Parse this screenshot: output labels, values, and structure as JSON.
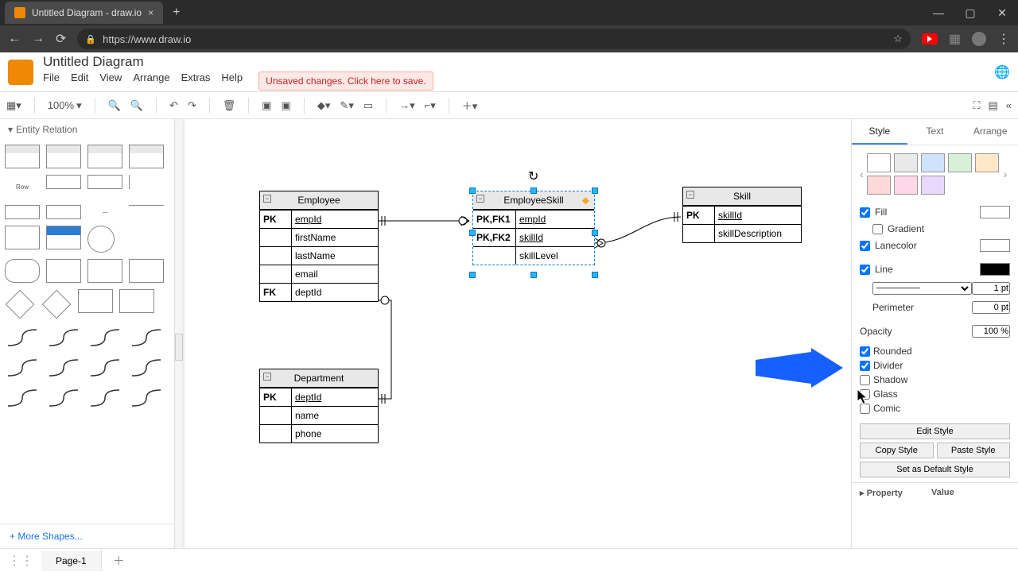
{
  "browser": {
    "tab_title": "Untitled Diagram - draw.io",
    "url": "https://www.draw.io"
  },
  "app": {
    "doc_title": "Untitled Diagram",
    "menus": [
      "File",
      "Edit",
      "View",
      "Arrange",
      "Extras",
      "Help"
    ],
    "unsaved_msg": "Unsaved changes. Click here to save.",
    "zoom": "100%"
  },
  "sidebar": {
    "category": "Entity Relation",
    "row_label": "Row",
    "more_shapes": "+ More Shapes..."
  },
  "canvas": {
    "tables": {
      "employee": {
        "title": "Employee",
        "rows": [
          {
            "k": "PK",
            "v": "empId",
            "u": true
          },
          {
            "k": "",
            "v": "firstName"
          },
          {
            "k": "",
            "v": "lastName"
          },
          {
            "k": "",
            "v": "email"
          },
          {
            "k": "FK",
            "v": "deptId"
          }
        ]
      },
      "employeeSkill": {
        "title": "EmployeeSkill",
        "rows": [
          {
            "k": "PK,FK1",
            "v": "empId",
            "u": true
          },
          {
            "k": "PK,FK2",
            "v": "skillId",
            "u": true
          },
          {
            "k": "",
            "v": "skillLevel"
          }
        ]
      },
      "skill": {
        "title": "Skill",
        "rows": [
          {
            "k": "PK",
            "v": "skillId",
            "u": true
          },
          {
            "k": "",
            "v": "skillDescription"
          }
        ]
      },
      "department": {
        "title": "Department",
        "rows": [
          {
            "k": "PK",
            "v": "deptId",
            "u": true
          },
          {
            "k": "",
            "v": "name"
          },
          {
            "k": "",
            "v": "phone"
          }
        ]
      }
    }
  },
  "style_panel": {
    "tabs": [
      "Style",
      "Text",
      "Arrange"
    ],
    "swatches": [
      "#ffffff",
      "#e0e0e0",
      "#cfe2ff",
      "#d8f0d8",
      "#ffe8c8",
      "#ffd8d8",
      "#ffd8e8",
      "#e8d8ff"
    ],
    "fill": {
      "label": "Fill",
      "checked": true,
      "color": "#ffffff"
    },
    "gradient": {
      "label": "Gradient",
      "checked": false
    },
    "lanecolor": {
      "label": "Lanecolor",
      "checked": true,
      "color": "#ffffff"
    },
    "line": {
      "label": "Line",
      "checked": true,
      "color": "#000000",
      "width": "1 pt"
    },
    "perimeter": {
      "label": "Perimeter",
      "value": "0 pt"
    },
    "opacity": {
      "label": "Opacity",
      "value": "100 %"
    },
    "checks": {
      "rounded": {
        "label": "Rounded",
        "checked": true
      },
      "divider": {
        "label": "Divider",
        "checked": true
      },
      "shadow": {
        "label": "Shadow",
        "checked": false
      },
      "glass": {
        "label": "Glass",
        "checked": false
      },
      "comic": {
        "label": "Comic",
        "checked": false
      }
    },
    "buttons": {
      "edit": "Edit Style",
      "copy": "Copy Style",
      "paste": "Paste Style",
      "default": "Set as Default Style"
    },
    "prop_header": {
      "k": "Property",
      "v": "Value"
    }
  },
  "footer": {
    "page": "Page-1"
  }
}
